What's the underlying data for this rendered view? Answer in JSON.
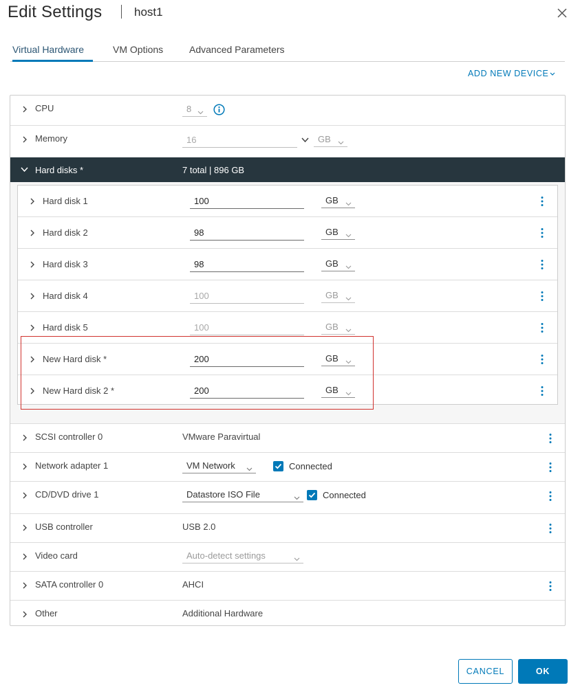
{
  "header": {
    "title": "Edit Settings",
    "host": "host1",
    "close_icon": "close-icon"
  },
  "tabs": [
    {
      "label": "Virtual Hardware",
      "active": true
    },
    {
      "label": "VM Options",
      "active": false
    },
    {
      "label": "Advanced Parameters",
      "active": false
    }
  ],
  "add_device": {
    "label": "ADD NEW DEVICE"
  },
  "cpu": {
    "label": "CPU",
    "value": "8"
  },
  "memory": {
    "label": "Memory",
    "value": "16",
    "unit": "GB"
  },
  "hard_disks": {
    "label": "Hard disks *",
    "summary": "7 total | 896 GB",
    "items": [
      {
        "label": "Hard disk 1",
        "size": "100",
        "unit": "GB",
        "editable": true
      },
      {
        "label": "Hard disk 2",
        "size": "98",
        "unit": "GB",
        "editable": true
      },
      {
        "label": "Hard disk 3",
        "size": "98",
        "unit": "GB",
        "editable": true
      },
      {
        "label": "Hard disk 4",
        "size": "100",
        "unit": "GB",
        "editable": false
      },
      {
        "label": "Hard disk 5",
        "size": "100",
        "unit": "GB",
        "editable": false
      },
      {
        "label": "New Hard disk *",
        "size": "200",
        "unit": "GB",
        "editable": true
      },
      {
        "label": "New Hard disk 2 *",
        "size": "200",
        "unit": "GB",
        "editable": true
      }
    ]
  },
  "scsi": {
    "label": "SCSI controller 0",
    "value": "VMware Paravirtual"
  },
  "network": {
    "label": "Network adapter 1",
    "value": "VM Network",
    "connected_label": "Connected",
    "connected": true
  },
  "cdrom": {
    "label": "CD/DVD drive 1",
    "value": "Datastore ISO File",
    "connected_label": "Connected",
    "connected": true
  },
  "usb": {
    "label": "USB controller",
    "value": "USB 2.0"
  },
  "video": {
    "label": "Video card",
    "value": "Auto-detect settings"
  },
  "sata": {
    "label": "SATA controller 0",
    "value": "AHCI"
  },
  "other": {
    "label": "Other",
    "value": "Additional Hardware"
  },
  "footer": {
    "cancel_label": "CANCEL",
    "ok_label": "OK"
  },
  "colors": {
    "accent": "#0079b8",
    "header_bar": "#27363e",
    "highlight": "#d0312d"
  }
}
